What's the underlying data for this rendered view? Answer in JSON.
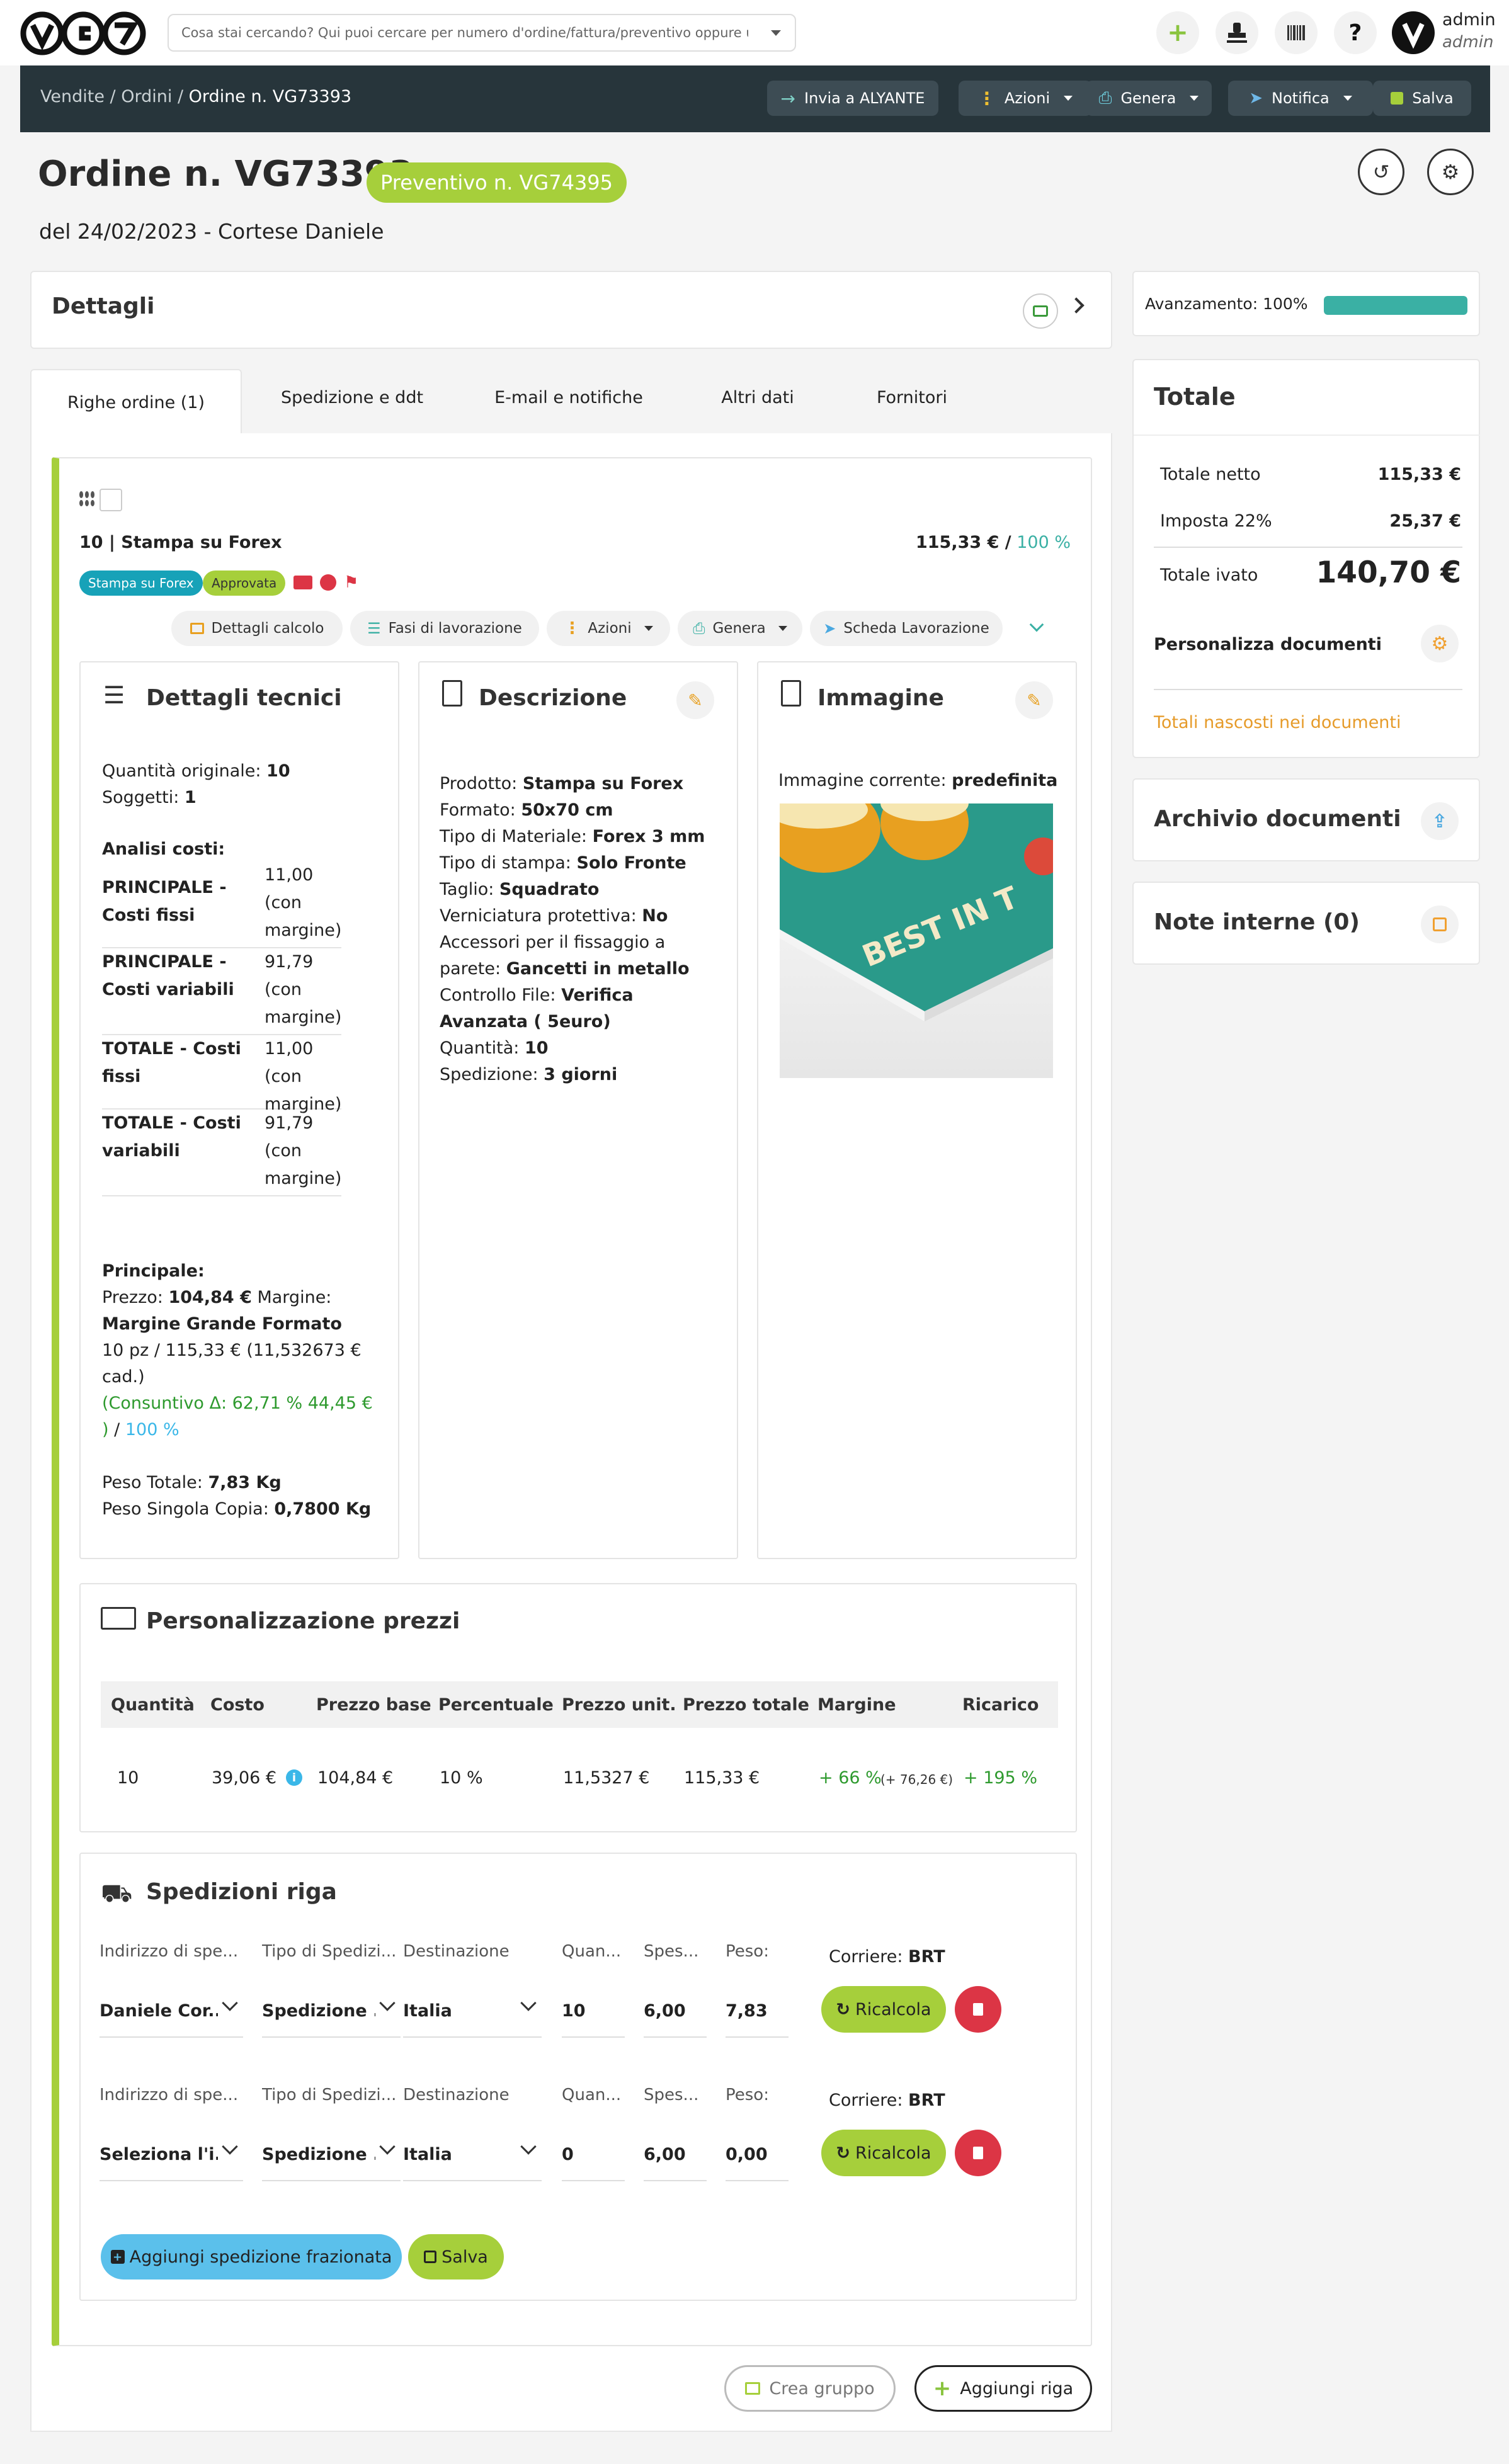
{
  "topbar": {
    "logo": "VG7",
    "search_placeholder": "Cosa stai cercando? Qui puoi cercare per numero d'ordine/fattura/preventivo oppure un cl...",
    "user_name": "admin",
    "user_role": "admin",
    "icons": [
      "plus-icon",
      "stamp-icon",
      "barcode-icon",
      "help-icon",
      "avatar"
    ]
  },
  "breadcrumb": {
    "items": [
      "Vendite",
      "Ordini",
      "Ordine n. VG73393"
    ],
    "separator": "/"
  },
  "actions": {
    "invia": "Invia a ALYANTE",
    "azioni": "Azioni",
    "genera": "Genera",
    "notifica": "Notifica",
    "salva": "Salva"
  },
  "header": {
    "title": "Ordine n. VG73393",
    "badge": "Preventivo n. VG74395",
    "subtitle": "del 24/02/2023 - Cortese Daniele"
  },
  "details_panel": {
    "title": "Dettagli"
  },
  "progress": {
    "label": "Avanzamento: 100%",
    "value": 1.0
  },
  "tabs": [
    {
      "label": "Righe ordine (1)",
      "active": true
    },
    {
      "label": "Spedizione e ddt",
      "active": false
    },
    {
      "label": "E-mail e notifiche",
      "active": false
    },
    {
      "label": "Altri dati",
      "active": false
    },
    {
      "label": "Fornitori",
      "active": false
    }
  ],
  "row": {
    "title": "10 | Stampa su Forex",
    "price": "115,33 € /",
    "percent": "100 %",
    "tags": [
      "Stampa su Forex",
      "Approvata"
    ],
    "toolbar": {
      "dettagli": "Dettagli calcolo",
      "fasi": "Fasi di lavorazione",
      "azioni": "Azioni",
      "genera": "Genera",
      "scheda": "Scheda Lavorazione"
    }
  },
  "tech": {
    "title": "Dettagli tecnici",
    "qty_label": "Quantità originale:",
    "qty_value": "10",
    "subj_label": "Soggetti:",
    "subj_value": "1",
    "costs_title": "Analisi costi:",
    "costs": [
      {
        "label": "PRINCIPALE - Costi fissi",
        "value": "11,00 (con margine)"
      },
      {
        "label": "PRINCIPALE - Costi variabili",
        "value": "91,79 (con margine)"
      },
      {
        "label": "TOTALE - Costi fissi",
        "value": "11,00 (con margine)"
      },
      {
        "label": "TOTALE - Costi variabili",
        "value": "91,79 (con margine)"
      }
    ],
    "principale_title": "Principale:",
    "prezzo_label": "Prezzo:",
    "prezzo_value": "104,84 €",
    "margine_label": "Margine:",
    "margine_value": "Margine Grande Formato",
    "detail_line": "10 pz / 115,33 € (11,532673 € cad.)",
    "consuntivo": "(Consuntivo Δ: 62,71 % 44,45 € )",
    "slash": "/",
    "percent": "100 %",
    "peso_totale_label": "Peso Totale:",
    "peso_totale_value": "7,83 Kg",
    "peso_copia_label": "Peso Singola Copia:",
    "peso_copia_value": "0,7800 Kg"
  },
  "description": {
    "title": "Descrizione",
    "fields": [
      {
        "label": "Prodotto:",
        "value": "Stampa su Forex"
      },
      {
        "label": "Formato:",
        "value": "50x70 cm"
      },
      {
        "label": "Tipo di Materiale:",
        "value": "Forex 3 mm"
      },
      {
        "label": "Tipo di stampa:",
        "value": "Solo Fronte"
      },
      {
        "label": "Taglio:",
        "value": "Squadrato"
      },
      {
        "label": "Verniciatura protettiva:",
        "value": "No"
      },
      {
        "label": "Accessori per il fissaggio a parete:",
        "value": "Gancetti in metallo"
      },
      {
        "label": "Controllo File:",
        "value": "Verifica Avanzata ( 5euro)"
      },
      {
        "label": "Quantità:",
        "value": "10"
      },
      {
        "label": "Spedizione:",
        "value": "3 giorni"
      }
    ]
  },
  "image_panel": {
    "title": "Immagine",
    "current_label": "Immagine corrente:",
    "current_value": "predefinita",
    "image_text": "BEST IN T"
  },
  "pricing": {
    "title": "Personalizzazione prezzi",
    "headers": [
      "Quantità",
      "Costo",
      "Prezzo base",
      "Percentuale",
      "Prezzo unit.",
      "Prezzo totale",
      "Margine",
      "Ricarico"
    ],
    "row": {
      "quantita": "10",
      "costo": "39,06 €",
      "prezzo_base": "104,84 €",
      "percentuale": "10 %",
      "prezzo_unit": "11,5327 €",
      "prezzo_totale": "115,33 €",
      "margine": "+ 66 %",
      "margine_extra": "(+ 76,26 €)",
      "ricarico": "+ 195 %"
    }
  },
  "shipping": {
    "title": "Spedizioni riga",
    "labels": [
      "Indirizzo di spe...",
      "Tipo di Spedizi...",
      "Destinazione",
      "Quan...",
      "Spes...",
      "Peso:"
    ],
    "corriere_label": "Corriere:",
    "rows": [
      {
        "indirizzo": "Daniele Cor...",
        "tipo": "Spedizione ...",
        "destinazione": "Italia",
        "quantita": "10",
        "spese": "6,00",
        "peso": "7,83",
        "corriere": "BRT"
      },
      {
        "indirizzo": "Seleziona l'i...",
        "tipo": "Spedizione ...",
        "destinazione": "Italia",
        "quantita": "0",
        "spese": "6,00",
        "peso": "0,00",
        "corriere": "BRT"
      }
    ],
    "ricalcola": "Ricalcola",
    "add_button": "Aggiungi spedizione frazionata",
    "save_button": "Salva"
  },
  "footer_buttons": {
    "crea_gruppo": "Crea gruppo",
    "aggiungi_riga": "Aggiungi riga"
  },
  "totals": {
    "title": "Totale",
    "netto_label": "Totale netto",
    "netto_value": "115,33 €",
    "imposta_label": "Imposta 22%",
    "imposta_value": "25,37 €",
    "ivato_label": "Totale ivato",
    "ivato_value": "140,70 €",
    "personalizza": "Personalizza documenti",
    "nascosti": "Totali nascosti nei documenti"
  },
  "archive": {
    "title": "Archivio documenti"
  },
  "notes": {
    "title": "Note interne (0)"
  },
  "colors": {
    "accent_green": "#a6cf3b",
    "teal": "#3ab0a4",
    "dark": "#3d4c54",
    "info_blue": "#5bc0eb",
    "danger": "#dc3545",
    "orange": "#f0a030"
  }
}
